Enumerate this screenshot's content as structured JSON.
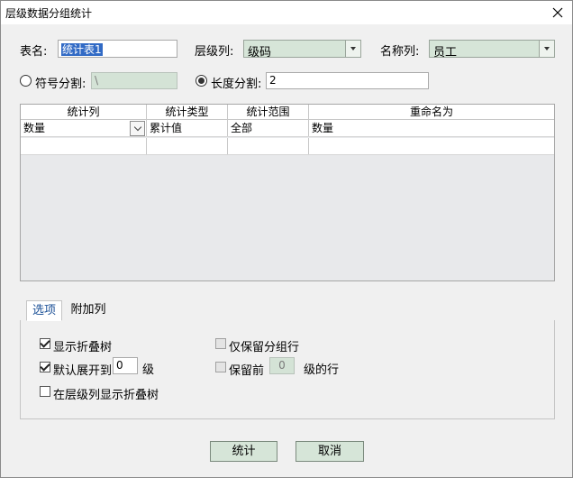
{
  "window": {
    "title": "层级数据分组统计"
  },
  "form": {
    "table_name_label": "表名:",
    "table_name_value": "统计表1",
    "level_column_label": "层级列:",
    "level_column_value": "级码",
    "name_column_label": "名称列:",
    "name_column_value": "员工",
    "symbol_split_label": "符号分割:",
    "symbol_split_value": "\\",
    "symbol_split_selected": false,
    "length_split_label": "长度分割:",
    "length_split_value": "2",
    "length_split_selected": true
  },
  "grid": {
    "columns": [
      "统计列",
      "统计类型",
      "统计范围",
      "重命名为"
    ],
    "rows": [
      [
        "数量",
        "累计值",
        "全部",
        "数量"
      ],
      [
        "",
        "",
        "",
        ""
      ]
    ]
  },
  "tabs": [
    {
      "label": "选项",
      "active": true
    },
    {
      "label": "附加列",
      "active": false
    }
  ],
  "options": {
    "show_fold_tree": {
      "label": "显示折叠树",
      "checked": true,
      "enabled": true
    },
    "default_expand": {
      "label": "默认展开到",
      "checked": true,
      "enabled": true,
      "value": "0",
      "suffix": "级"
    },
    "show_fold_tree_in_level_col": {
      "label": "在层级列显示折叠树",
      "checked": false,
      "enabled": true
    },
    "keep_group_rows_only": {
      "label": "仅保留分组行",
      "checked": false,
      "enabled": false
    },
    "keep_first": {
      "label": "保留前",
      "checked": false,
      "enabled": false,
      "value": "0",
      "suffix": "级的行"
    }
  },
  "buttons": {
    "ok_label": "统计",
    "cancel_label": "取消"
  },
  "icons": {
    "close": "close-icon",
    "dropdown": "chevron-down-icon",
    "check": "checkmark-icon"
  },
  "colors": {
    "control_green": "#d6e5d8",
    "selection_blue": "#316ac5",
    "tab_active_text": "#1a4f96"
  }
}
